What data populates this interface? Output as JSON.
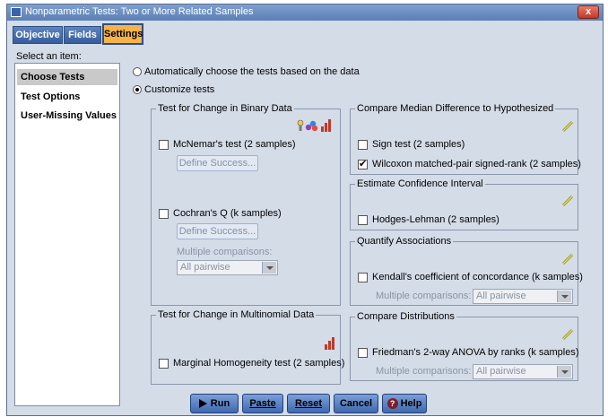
{
  "window": {
    "title": "Nonparametric Tests: Two or More Related Samples",
    "close_label": "x"
  },
  "tabs": [
    {
      "label": "Objective"
    },
    {
      "label": "Fields"
    },
    {
      "label": "Settings"
    }
  ],
  "select_label": "Select an item:",
  "sidebar": {
    "items": [
      {
        "label": "Choose Tests"
      },
      {
        "label": "Test Options"
      },
      {
        "label": "User-Missing Values"
      }
    ]
  },
  "mode": {
    "auto_label": "Automatically choose the tests based on the data",
    "custom_label": "Customize tests",
    "selected": "custom"
  },
  "binary_group": {
    "title": "Test for Change in Binary Data",
    "mcnemar_label": "McNemar's test (2 samples)",
    "mcnemar_checked": false,
    "define_success_1": "Define Success...",
    "cochran_label": "Cochran's Q (k samples)",
    "cochran_checked": false,
    "define_success_2": "Define Success...",
    "multiple_comparisons_label": "Multiple comparisons:",
    "multiple_comparisons_value": "All pairwise"
  },
  "multinomial_group": {
    "title": "Test for Change in Multinomial Data",
    "marginal_label": "Marginal Homogeneity test (2 samples)",
    "marginal_checked": false
  },
  "median_group": {
    "title": "Compare Median Difference to Hypothesized",
    "sign_label": "Sign test (2 samples)",
    "sign_checked": false,
    "wilcoxon_label": "Wilcoxon matched-pair signed-rank (2 samples)",
    "wilcoxon_checked": true
  },
  "ci_group": {
    "title": "Estimate Confidence Interval",
    "hodges_label": "Hodges-Lehman (2 samples)",
    "hodges_checked": false
  },
  "assoc_group": {
    "title": "Quantify Associations",
    "kendall_label": "Kendall's coefficient of concordance (k samples)",
    "kendall_checked": false,
    "multiple_comparisons_label": "Multiple comparisons:",
    "multiple_comparisons_value": "All pairwise"
  },
  "dist_group": {
    "title": "Compare Distributions",
    "friedman_label": "Friedman's 2-way ANOVA by ranks (k samples)",
    "friedman_checked": false,
    "multiple_comparisons_label": "Multiple comparisons:",
    "multiple_comparisons_value": "All pairwise"
  },
  "buttons": {
    "run": "Run",
    "paste": "Paste",
    "reset": "Reset",
    "cancel": "Cancel",
    "help": "Help"
  },
  "colors": {
    "active_tab": "#f5b34a",
    "tab": "#4a74b4",
    "panel_bg": "#d4dce8"
  }
}
